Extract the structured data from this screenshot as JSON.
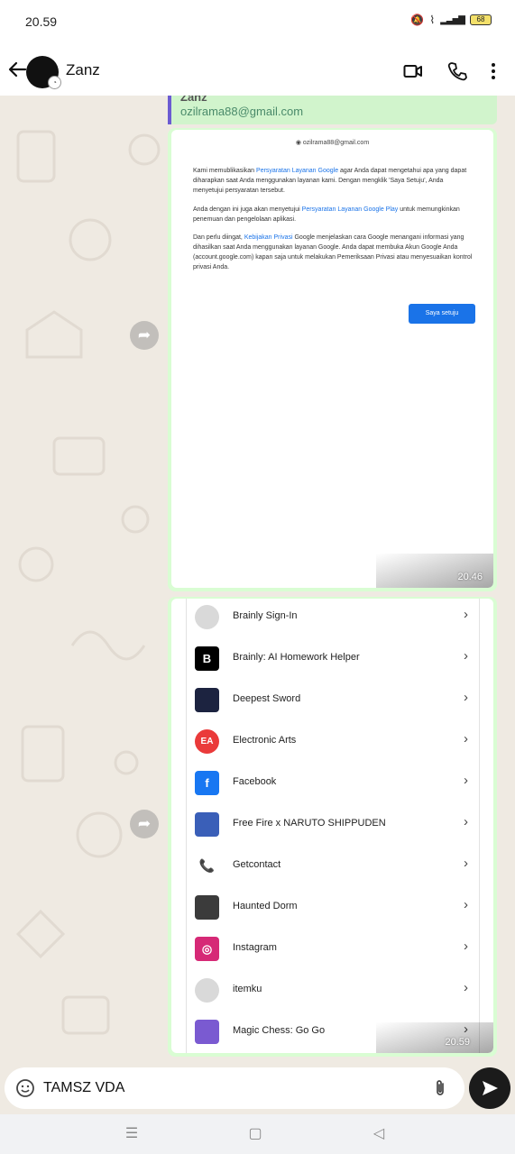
{
  "status": {
    "time": "20.59",
    "battery": "68"
  },
  "header": {
    "contact_name": "Zanz"
  },
  "quote": {
    "name": "Zanz",
    "email": "ozilrama88@gmail.com"
  },
  "google_terms": {
    "account": "ozilrama88@gmail.com",
    "para1_pre": "Kami memublikasikan ",
    "para1_link": "Persyaratan Layanan Google",
    "para1_post": " agar Anda dapat mengetahui apa yang dapat diharapkan saat Anda menggunakan layanan kami. Dengan mengklik 'Saya Setuju', Anda menyetujui persyaratan tersebut.",
    "para2_pre": "Anda dengan ini juga akan menyetujui ",
    "para2_link": "Persyaratan Layanan Google Play",
    "para2_post": " untuk memungkinkan penemuan dan pengelolaan aplikasi.",
    "para3_pre": "Dan perlu diingat, ",
    "para3_link": "Kebijakan Privasi",
    "para3_post": " Google menjelaskan cara Google menangani informasi yang dihasilkan saat Anda menggunakan layanan Google. Anda dapat membuka Akun Google Anda (account.google.com) kapan saja untuk melakukan Pemeriksaan Privasi atau menyesuaikan kontrol privasi Anda.",
    "agree_button": "Saya setuju",
    "timestamp": "20.46"
  },
  "apps": {
    "items": [
      {
        "name": "Brainly Sign-In",
        "icon": "brainly-signin-icon",
        "color": "#d9d9d9"
      },
      {
        "name": "Brainly: AI Homework Helper",
        "icon": "brainly-icon",
        "color": "#000000"
      },
      {
        "name": "Deepest Sword",
        "icon": "deepest-sword-icon",
        "color": "#1c2340"
      },
      {
        "name": "Electronic Arts",
        "icon": "ea-icon",
        "color": "#ea3a3a"
      },
      {
        "name": "Facebook",
        "icon": "facebook-icon",
        "color": "#1877f2"
      },
      {
        "name": "Free Fire x NARUTO SHIPPUDEN",
        "icon": "free-fire-icon",
        "color": "#3a5fb8"
      },
      {
        "name": "Getcontact",
        "icon": "getcontact-icon",
        "color": "#ffffff"
      },
      {
        "name": "Haunted Dorm",
        "icon": "haunted-dorm-icon",
        "color": "#3b3b3b"
      },
      {
        "name": "Instagram",
        "icon": "instagram-icon",
        "color": "#d62976"
      },
      {
        "name": "itemku",
        "icon": "itemku-icon",
        "color": "#d9d9d9"
      },
      {
        "name": "Magic Chess: Go Go",
        "icon": "magic-chess-icon",
        "color": "#7a5ad1"
      }
    ],
    "timestamp": "20.59"
  },
  "input": {
    "text": "TAMSZ VDA"
  }
}
